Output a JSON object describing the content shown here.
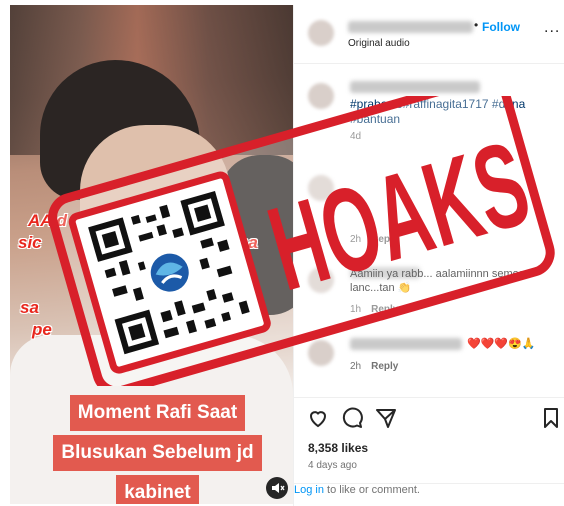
{
  "video": {
    "overlay_lines": [
      "AA d",
      "wo",
      "sic",
      "na",
      "sa",
      "pe",
      "a"
    ],
    "caption_lines": [
      "Moment Rafi Saat",
      "Blusukan Sebelum jd",
      "kabinet"
    ],
    "mute_icon": "speaker-muted-icon"
  },
  "post": {
    "follow_label": "Follow",
    "dot": "•",
    "more_label": "...",
    "audio_label": "Original audio",
    "hashtags": "#prabowo#raffinagita1717 #dana #bantuan",
    "hashtags_time": "4d",
    "comments": [
      {
        "time": "2h",
        "reply_label": "Reply",
        "text": ""
      },
      {
        "time": "1h",
        "reply_label": "Reply",
        "text": "Aamiin ya rabb... aalamiinnn semoga lanc...tan 👏"
      },
      {
        "time": "2h",
        "reply_label": "Reply",
        "text": "❤️❤️❤️😍🙏"
      }
    ],
    "likes": "8,358 likes",
    "posted": "4 days ago",
    "login_link": "Log in",
    "login_rest": " to like or comment."
  },
  "stamp": {
    "text": "HOAKS",
    "color": "#d8202a",
    "logo": "kominfo-logo"
  }
}
